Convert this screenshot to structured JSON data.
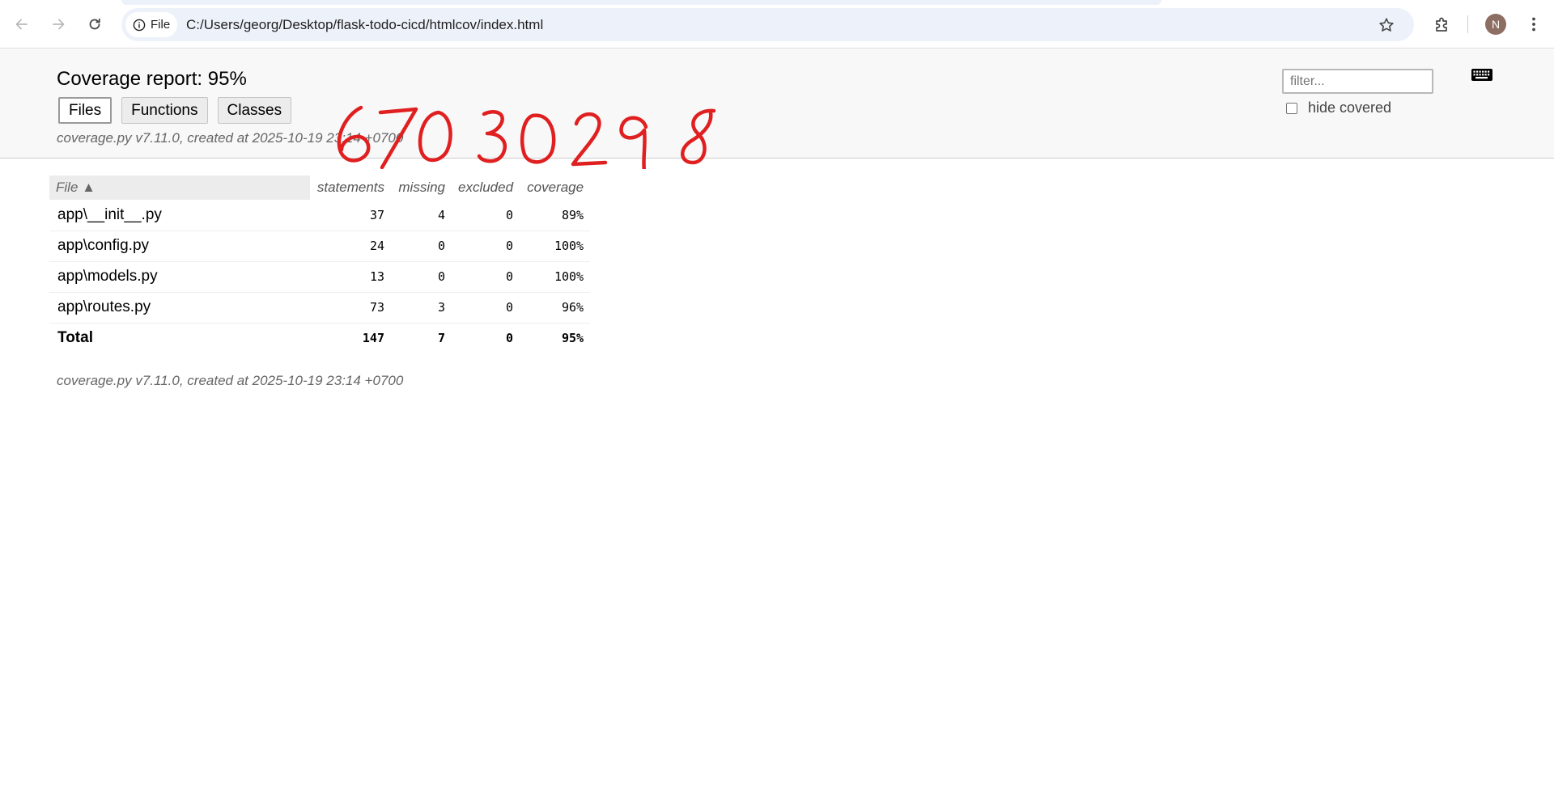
{
  "browser": {
    "site_chip_label": "File",
    "url": "C:/Users/georg/Desktop/flask-todo-cicd/htmlcov/index.html",
    "avatar_initial": "N"
  },
  "report": {
    "title": "Coverage report: 95%",
    "tabs": [
      {
        "label": "Files",
        "active": true
      },
      {
        "label": "Functions",
        "active": false
      },
      {
        "label": "Classes",
        "active": false
      }
    ],
    "created": "coverage.py v7.11.0, created at 2025-10-19 23:14 +0700",
    "filter_placeholder": "filter...",
    "hide_covered_label": "hide covered",
    "hide_covered_checked": false,
    "handwritten_annotation": "67030298",
    "annotation_color": "#e02020"
  },
  "table": {
    "headers": {
      "file": "File ▲",
      "statements": "statements",
      "missing": "missing",
      "excluded": "excluded",
      "coverage": "coverage"
    },
    "rows": [
      {
        "file": "app\\__init__.py",
        "statements": "37",
        "missing": "4",
        "excluded": "0",
        "coverage": "89%"
      },
      {
        "file": "app\\config.py",
        "statements": "24",
        "missing": "0",
        "excluded": "0",
        "coverage": "100%"
      },
      {
        "file": "app\\models.py",
        "statements": "13",
        "missing": "0",
        "excluded": "0",
        "coverage": "100%"
      },
      {
        "file": "app\\routes.py",
        "statements": "73",
        "missing": "3",
        "excluded": "0",
        "coverage": "96%"
      }
    ],
    "total": {
      "file": "Total",
      "statements": "147",
      "missing": "7",
      "excluded": "0",
      "coverage": "95%"
    }
  },
  "footer": {
    "created": "coverage.py v7.11.0, created at 2025-10-19 23:14 +0700"
  }
}
